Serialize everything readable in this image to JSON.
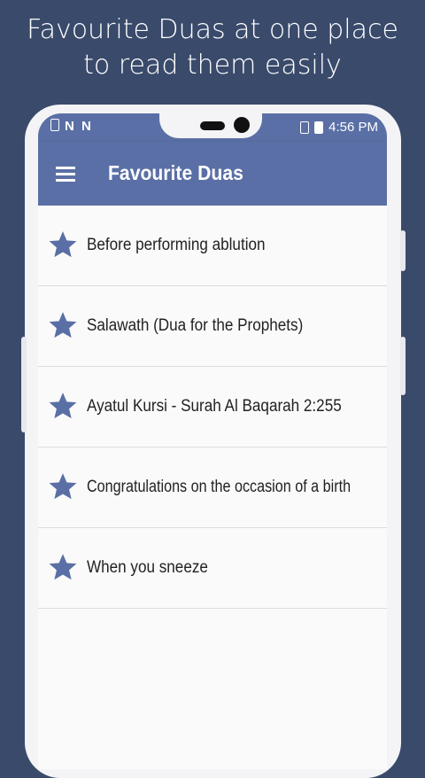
{
  "headline": {
    "line1": "Favourite Duas at one place",
    "line2": "to read them easily"
  },
  "statusbar": {
    "left_icons": "N N",
    "time": "4:56 PM"
  },
  "toolbar": {
    "title": "Favourite Duas",
    "menu_icon": "hamburger-menu-icon"
  },
  "items": [
    {
      "label": "Before performing ablution",
      "icon": "star-icon"
    },
    {
      "label": "Salawath (Dua for the Prophets)",
      "icon": "star-icon"
    },
    {
      "label": "Ayatul Kursi - Surah Al Baqarah 2:255",
      "icon": "star-icon"
    },
    {
      "label": "Congratulations on the occasion of a birth",
      "icon": "star-icon"
    },
    {
      "label": "When you sneeze",
      "icon": "star-icon"
    }
  ],
  "colors": {
    "background": "#3a4a6b",
    "primary": "#5a6fa5",
    "star": "#5a6fa5"
  }
}
